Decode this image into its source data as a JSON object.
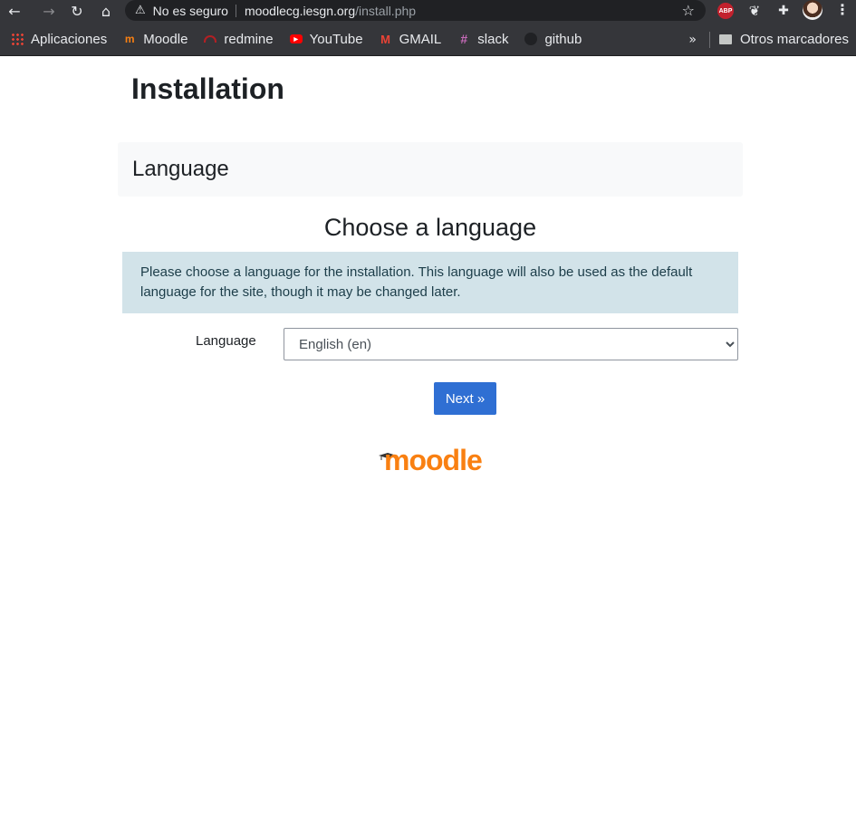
{
  "browser": {
    "security_label": "No es seguro",
    "url_host": "moodlecg.iesgn.org",
    "url_path": "/install.php",
    "abp_label": "ABP",
    "bookmarks": [
      {
        "label": "Aplicaciones"
      },
      {
        "label": "Moodle"
      },
      {
        "label": "redmine"
      },
      {
        "label": "YouTube"
      },
      {
        "label": "GMAIL"
      },
      {
        "label": "slack"
      },
      {
        "label": "github"
      }
    ],
    "overflow_label": "»",
    "other_bookmarks": "Otros marcadores"
  },
  "page": {
    "title": "Installation",
    "section_heading": "Language",
    "choose_heading": "Choose a language",
    "info_text": "Please choose a language for the installation. This language will also be used as the default language for the site, though it may be changed later.",
    "language_label": "Language",
    "language_selected": "English (en)",
    "next_button": "Next »",
    "logo_text": "moodle"
  },
  "colors": {
    "chrome": "#35363a",
    "omnibox": "#202124",
    "info_bg": "#d2e3e9",
    "button": "#2f6fd3",
    "moodle_orange": "#f98012"
  }
}
